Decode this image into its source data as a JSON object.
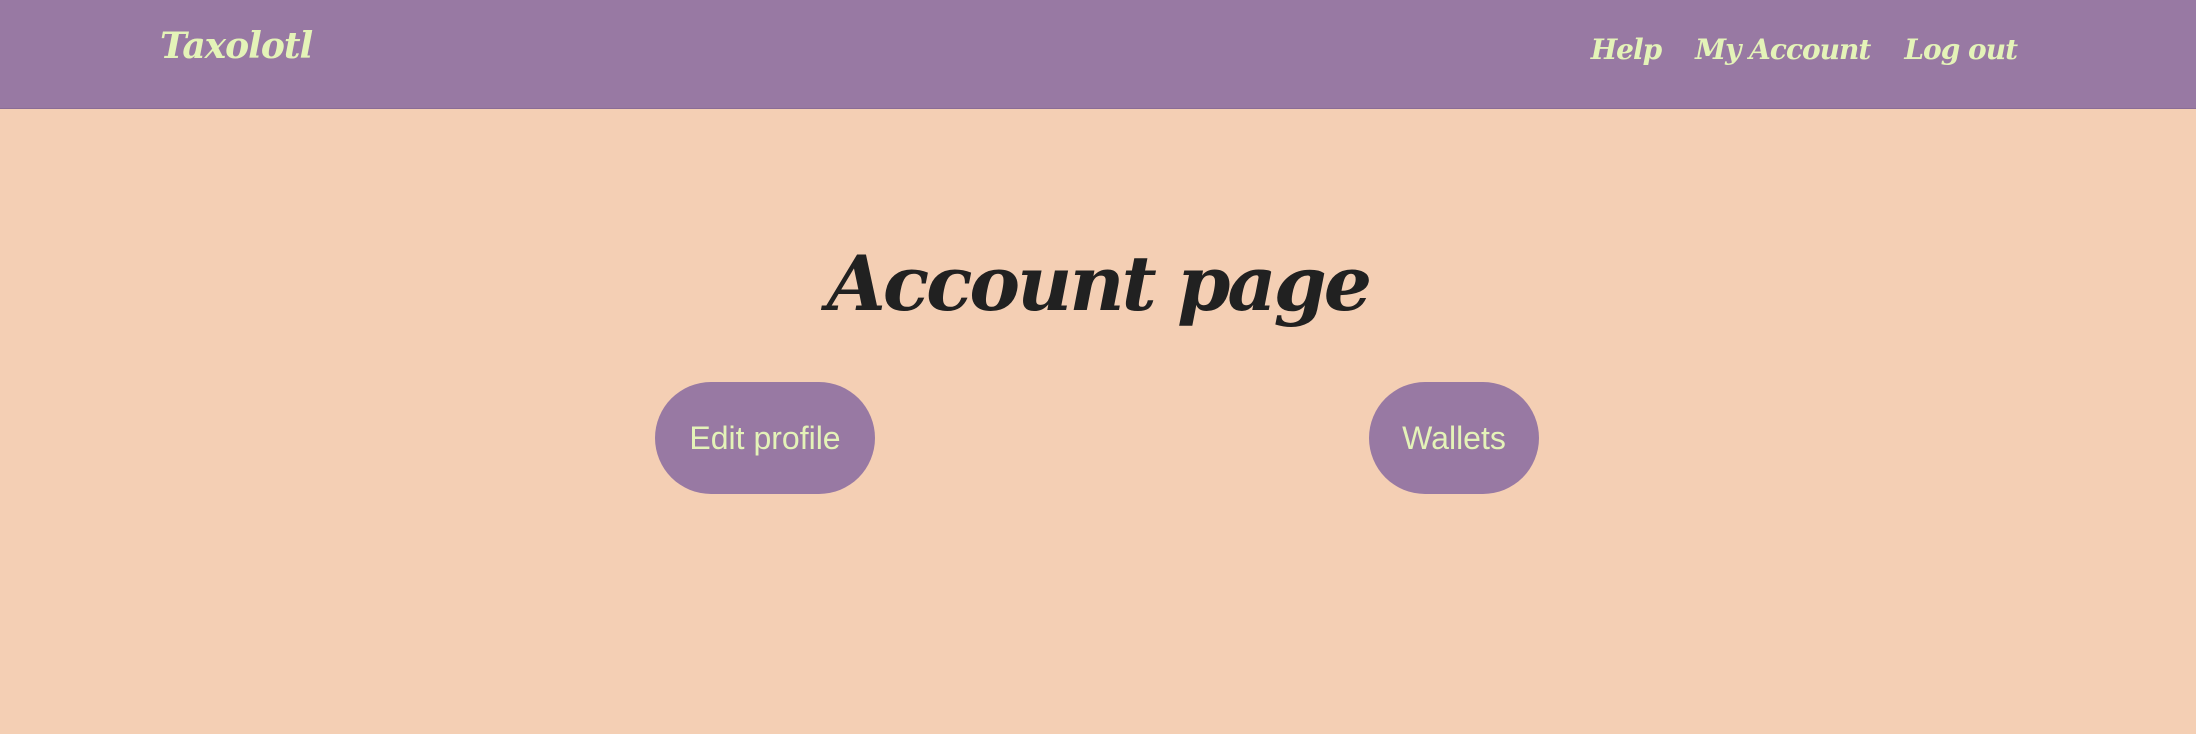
{
  "navbar": {
    "brand": "Taxolotl",
    "links": [
      {
        "label": "Help"
      },
      {
        "label": "My Account"
      },
      {
        "label": "Log out"
      }
    ]
  },
  "main": {
    "title": "Account page",
    "buttons": {
      "edit_profile": "Edit profile",
      "wallets": "Wallets"
    }
  },
  "colors": {
    "background": "#f4cfb4",
    "navbar": "#9879a3",
    "accent_text": "#e4f3b8",
    "title_text": "#212121"
  }
}
